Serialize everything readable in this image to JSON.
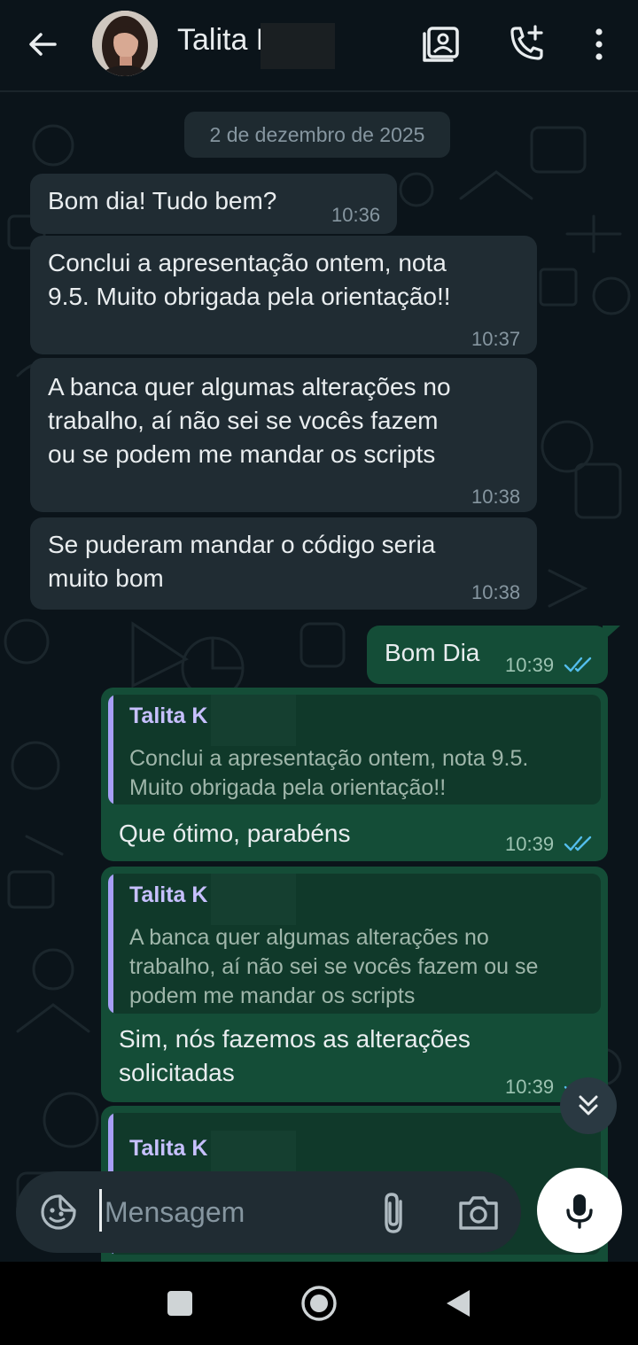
{
  "header": {
    "contact_name": "Talita K",
    "icons": [
      "back-arrow-icon",
      "avatar",
      "contact-card-icon",
      "add-call-icon",
      "more-vertical-icon"
    ]
  },
  "chat": {
    "date_separator": "2 de dezembro de 2025",
    "messages": [
      {
        "direction": "in",
        "lines": [
          "Bom dia! Tudo bem?"
        ],
        "time": "10:36"
      },
      {
        "direction": "in",
        "lines": [
          "Conclui a apresentação ontem, nota",
          "9.5. Muito obrigada pela orientação!!"
        ],
        "time": "10:37"
      },
      {
        "direction": "in",
        "lines": [
          "A banca quer algumas alterações no",
          "trabalho, aí não sei se vocês fazem",
          "ou se podem me mandar os scripts"
        ],
        "time": "10:38"
      },
      {
        "direction": "in",
        "lines": [
          "Se puderam mandar o código seria",
          "muito bom"
        ],
        "time": "10:38"
      },
      {
        "direction": "out",
        "lines": [
          "Bom Dia"
        ],
        "time": "10:39",
        "status": "read"
      },
      {
        "direction": "out",
        "quote": {
          "author": "Talita K",
          "lines": [
            "Conclui a apresentação ontem, nota 9.5.",
            "Muito obrigada pela orientação!!"
          ]
        },
        "lines": [
          "Que ótimo, parabéns"
        ],
        "time": "10:39",
        "status": "read"
      },
      {
        "direction": "out",
        "quote": {
          "author": "Talita K",
          "lines": [
            "A banca quer algumas alterações no",
            "trabalho, aí não sei se vocês fazem ou se",
            "podem me mandar os scripts"
          ]
        },
        "lines": [
          "Sim, nós fazemos as alterações",
          "solicitadas"
        ],
        "time": "10:39",
        "status": "read"
      },
      {
        "direction": "out",
        "quote": {
          "author": "Talita K"
        },
        "partial": true
      }
    ]
  },
  "composer": {
    "placeholder": "Mensagem"
  },
  "colors": {
    "background": "#0b141a",
    "incoming_bubble": "#202c33",
    "outgoing_bubble": "#144d37",
    "read_ticks": "#53bdeb",
    "quote_accent": "#a79ff6"
  }
}
